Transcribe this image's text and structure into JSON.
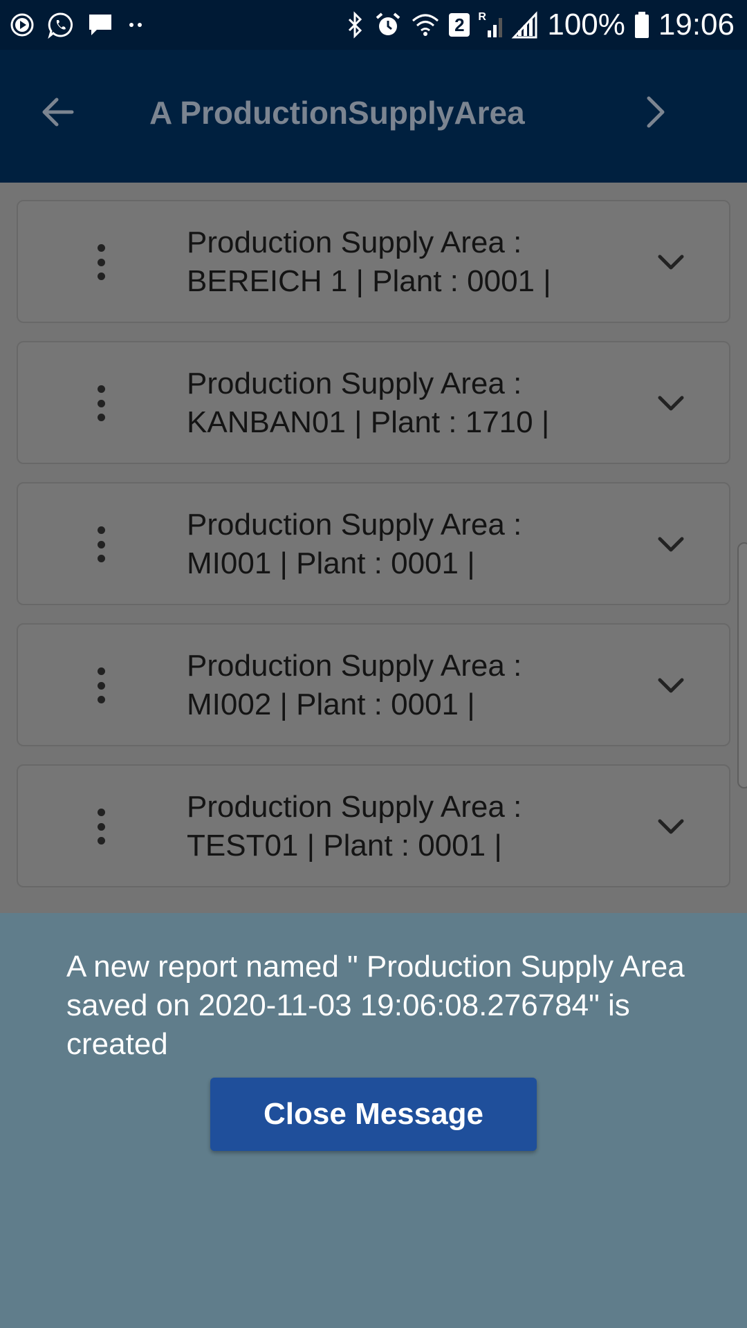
{
  "status_bar": {
    "left_icons": [
      "play-circle-icon",
      "whatsapp-icon",
      "chat-bubble-icon",
      "more-dots-icon"
    ],
    "right_icons": [
      "bluetooth-icon",
      "alarm-icon",
      "wifi-icon",
      "sim-2-icon",
      "signal-roaming-icon",
      "signal-icon",
      "battery-icon"
    ],
    "sim_label": "2",
    "roaming_label": "R",
    "battery": "100%",
    "time": "19:06"
  },
  "app_bar": {
    "title": "A ProductionSupplyArea",
    "back_icon": "arrow-left-icon",
    "next_icon": "chevron-right-icon"
  },
  "list": {
    "items": [
      {
        "line1": "Production Supply Area :",
        "line2": "BEREICH 1 | Plant : 0001 |"
      },
      {
        "line1": "Production Supply Area :",
        "line2": "KANBAN01 | Plant : 1710 |"
      },
      {
        "line1": "Production Supply Area :",
        "line2": "MI001 | Plant : 0001 |"
      },
      {
        "line1": "Production Supply Area :",
        "line2": "MI002 | Plant : 0001 |"
      },
      {
        "line1": "Production Supply Area :",
        "line2": "TEST01 | Plant : 0001 |"
      }
    ]
  },
  "message": {
    "text": "A new report named \" Production Supply Area saved on 2020-11-03 19:06:08.276784\" is created",
    "close_label": "Close Message"
  },
  "colors": {
    "status_bar": "#001a35",
    "app_bar": "#00203f",
    "overlay": "#747474",
    "message_panel": "#607d8b",
    "close_button": "#1f4f9b"
  }
}
